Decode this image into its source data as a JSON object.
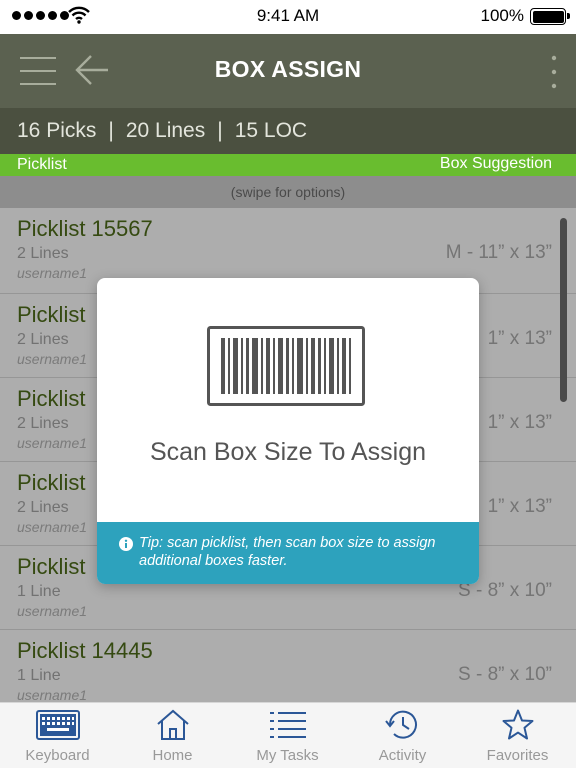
{
  "status_bar": {
    "time": "9:41 AM",
    "battery": "100%"
  },
  "header": {
    "title": "BOX ASSIGN",
    "icons": [
      "menu-icon",
      "back-arrow-icon",
      "more-vertical-icon"
    ]
  },
  "stats": {
    "picks": "16 Picks",
    "lines": "20 Lines",
    "loc": "15 LOC",
    "separator": "|"
  },
  "columns": {
    "left": "Picklist",
    "right": "Box Suggestion"
  },
  "swipe_hint": "(swipe for options)",
  "picklists": [
    {
      "name": "Picklist 15567",
      "lines": "2 Lines",
      "user": "username1",
      "box": "M - 11” x 13”"
    },
    {
      "name": "Picklist",
      "lines": "2 Lines",
      "user": "username1",
      "box": "1” x 13”"
    },
    {
      "name": "Picklist",
      "lines": "2 Lines",
      "user": "username1",
      "box": "1” x 13”"
    },
    {
      "name": "Picklist",
      "lines": "2 Lines",
      "user": "username1",
      "box": "1” x 13”"
    },
    {
      "name": "Picklist",
      "lines": "1 Line",
      "user": "username1",
      "box": "S - 8” x 10”"
    },
    {
      "name": "Picklist 14445",
      "lines": "1 Line",
      "user": "username1",
      "box": "S - 8” x 10”"
    }
  ],
  "modal": {
    "icon": "barcode-icon",
    "message": "Scan Box Size To Assign",
    "tip": "Tip: scan picklist, then scan box size to assign additional boxes faster."
  },
  "tabs": [
    {
      "label": "Keyboard",
      "icon": "keyboard-icon"
    },
    {
      "label": "Home",
      "icon": "home-icon"
    },
    {
      "label": "My Tasks",
      "icon": "list-icon"
    },
    {
      "label": "Activity",
      "icon": "clock-history-icon"
    },
    {
      "label": "Favorites",
      "icon": "star-icon"
    }
  ],
  "colors": {
    "header": "#5b6150",
    "stats_bar": "#4b5040",
    "accent_green": "#69bd2f",
    "picklist_name": "#4f6d1a",
    "tip_bg": "#2da2bd",
    "keyboard_icon": "#2b5797"
  }
}
